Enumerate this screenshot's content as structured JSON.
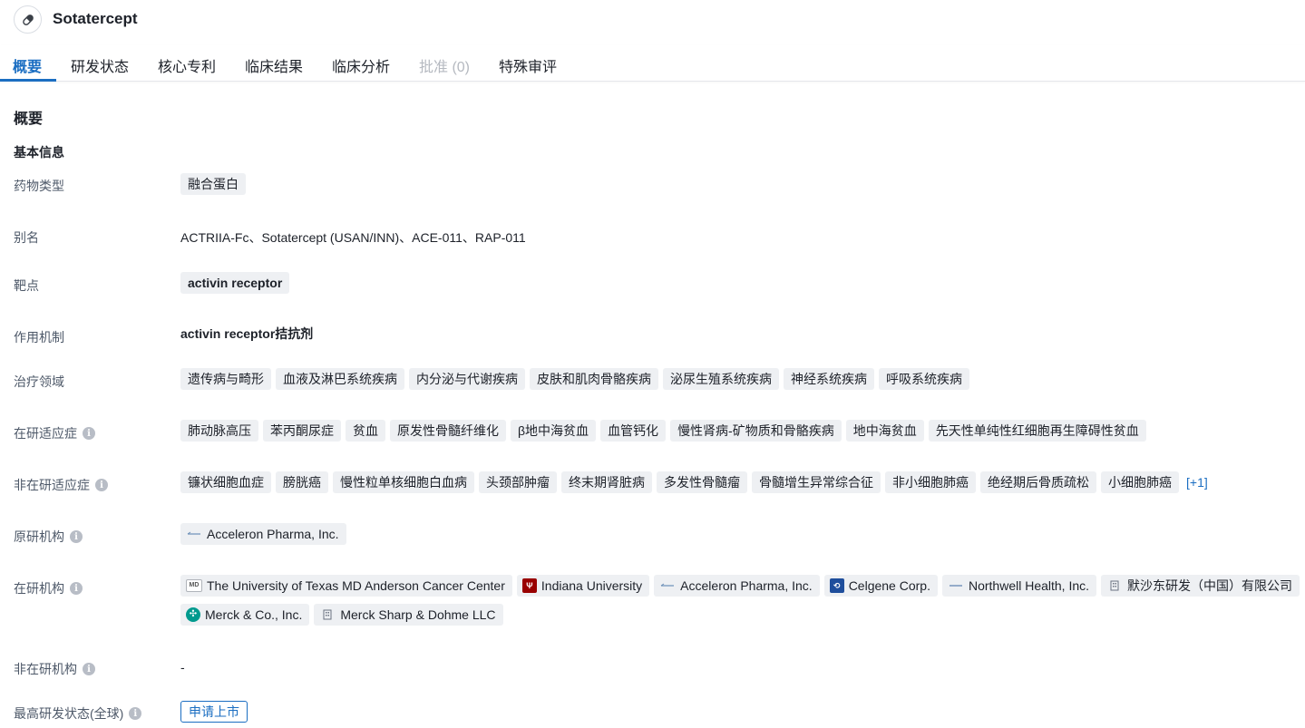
{
  "drug": {
    "name": "Sotatercept",
    "icon": "pill-icon"
  },
  "tabs": [
    {
      "label": "概要",
      "active": true
    },
    {
      "label": "研发状态"
    },
    {
      "label": "核心专利"
    },
    {
      "label": "临床结果"
    },
    {
      "label": "临床分析"
    },
    {
      "label": "批准 (0)",
      "disabled": true
    },
    {
      "label": "特殊审评"
    }
  ],
  "section_title": "概要",
  "basic_info_title": "基本信息",
  "rows": {
    "drug_type": {
      "label": "药物类型",
      "tags": [
        "融合蛋白"
      ]
    },
    "alias": {
      "label": "别名",
      "text": "ACTRIIA-Fc、Sotatercept (USAN/INN)、ACE-011、RAP-011"
    },
    "target": {
      "label": "靶点",
      "tags": [
        "activin receptor"
      ]
    },
    "mechanism": {
      "label": "作用机制",
      "text": "activin receptor拮抗剂"
    },
    "therapy_area": {
      "label": "治疗领域",
      "tags": [
        "遗传病与畸形",
        "血液及淋巴系统疾病",
        "内分泌与代谢疾病",
        "皮肤和肌肉骨骼疾病",
        "泌尿生殖系统疾病",
        "神经系统疾病",
        "呼吸系统疾病"
      ]
    },
    "active_indications": {
      "label": "在研适应症",
      "tags": [
        "肺动脉高压",
        "苯丙酮尿症",
        "贫血",
        "原发性骨髓纤维化",
        "β地中海贫血",
        "血管钙化",
        "慢性肾病-矿物质和骨骼疾病",
        "地中海贫血",
        "先天性单纯性红细胞再生障碍性贫血"
      ]
    },
    "inactive_indications": {
      "label": "非在研适应症",
      "tags": [
        "镰状细胞血症",
        "膀胱癌",
        "慢性粒单核细胞白血病",
        "头颈部肿瘤",
        "终末期肾脏病",
        "多发性骨髓瘤",
        "骨髓增生异常综合征",
        "非小细胞肺癌",
        "绝经期后骨质疏松",
        "小细胞肺癌"
      ],
      "more": "[+1]"
    },
    "originator": {
      "label": "原研机构",
      "orgs": [
        {
          "name": "Acceleron Pharma, Inc.",
          "logo": "acceleron-logo"
        }
      ]
    },
    "active_orgs": {
      "label": "在研机构",
      "orgs_line1": [
        {
          "name": "The University of Texas MD Anderson Cancer Center",
          "logo": "md-anderson-logo"
        },
        {
          "name": "Indiana University",
          "logo": "indiana-logo"
        },
        {
          "name": "Acceleron Pharma, Inc.",
          "logo": "acceleron-logo"
        },
        {
          "name": "Celgene Corp.",
          "logo": "celgene-logo"
        },
        {
          "name": "Northwell Health, Inc.",
          "logo": "northwell-logo"
        },
        {
          "name": "默沙东研发（中国）有限公司",
          "logo": "building-icon"
        }
      ],
      "orgs_line2": [
        {
          "name": "Merck & Co., Inc.",
          "logo": "merck-logo"
        },
        {
          "name": "Merck Sharp & Dohme LLC",
          "logo": "building-icon"
        }
      ]
    },
    "inactive_orgs": {
      "label": "非在研机构",
      "text": "-"
    },
    "highest_status": {
      "label": "最高研发状态(全球)",
      "status": "申请上市"
    }
  },
  "colors": {
    "accent": "#1b6ec2",
    "tag_bg": "#eef0f3"
  }
}
